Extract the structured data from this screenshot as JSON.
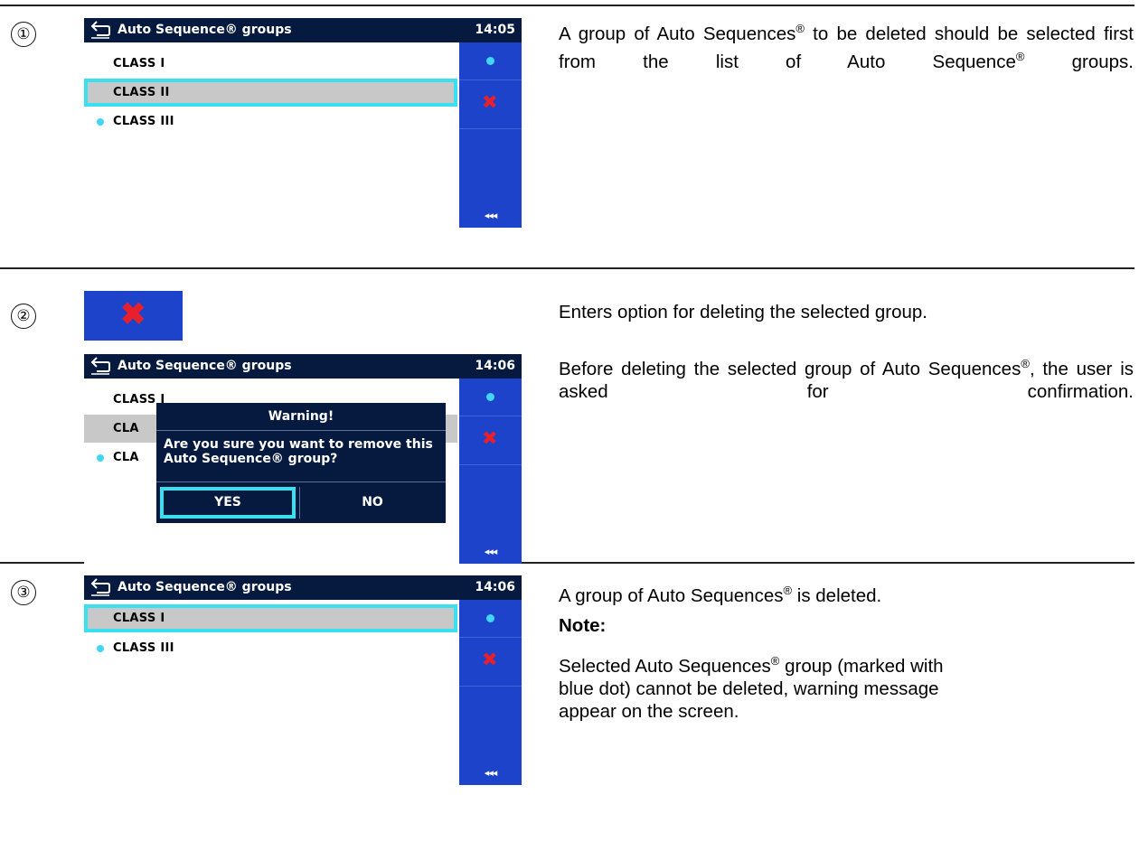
{
  "steps": [
    {
      "number": "①",
      "screen": {
        "title": "Auto Sequence® groups",
        "time": "14:05",
        "items": [
          {
            "label": "CLASS I",
            "selected": false,
            "dot": false
          },
          {
            "label": "CLASS II",
            "selected": true,
            "dot": false
          },
          {
            "label": "CLASS III",
            "selected": false,
            "dot": true
          }
        ],
        "more_label": "◂◂◂"
      },
      "description": {
        "line1_a": "A group of Auto Sequences",
        "line1_sup": "®",
        "line1_b": " to be deleted should be selected first from the list of Auto Sequence",
        "line1_sup2": "®",
        "line1_c": " groups."
      }
    },
    {
      "number": "②",
      "screen": {
        "title": "Auto Sequence® groups",
        "time": "14:06",
        "items": [
          {
            "label": "CLASS I"
          },
          {
            "label": "CLA"
          },
          {
            "label": "CLA"
          }
        ],
        "dialog": {
          "title": "Warning!",
          "message": "Are you sure you want to remove this Auto Sequence® group?",
          "yes": "YES",
          "no": "NO"
        },
        "more_label": "◂◂◂"
      },
      "description": {
        "p1": "Enters option for deleting the selected group.",
        "p2_a": "Before deleting the selected group of Auto Sequences",
        "p2_sup": "®",
        "p2_b": ", the user is asked for confirmation."
      }
    },
    {
      "number": "③",
      "screen": {
        "title": "Auto Sequence® groups",
        "time": "14:06",
        "items": [
          {
            "label": "CLASS I",
            "selected": true,
            "dot": false
          },
          {
            "label": "CLASS III",
            "selected": false,
            "dot": true
          }
        ],
        "more_label": "◂◂◂"
      },
      "description": {
        "p1_a": "A group of Auto Sequences",
        "p1_sup": "®",
        "p1_b": " is deleted.",
        "note_label": "Note:",
        "p2_a": "Selected Auto Sequences",
        "p2_sup": "®",
        "p2_b": " group (marked with blue dot) cannot be deleted, warning message appear on the screen."
      }
    }
  ],
  "colors": {
    "header_bg": "#061a3f",
    "side_bg": "#1c43c9",
    "focus_outline": "#3ae0f0",
    "delete_x": "#e8202c",
    "selected_row": "#c8c8c8",
    "dot": "#41d6f5"
  },
  "icons": {
    "back": "back-arrow-icon",
    "delete": "delete-x-icon",
    "active_group": "blue-dot-icon",
    "more": "triple-arrow-left-icon"
  }
}
